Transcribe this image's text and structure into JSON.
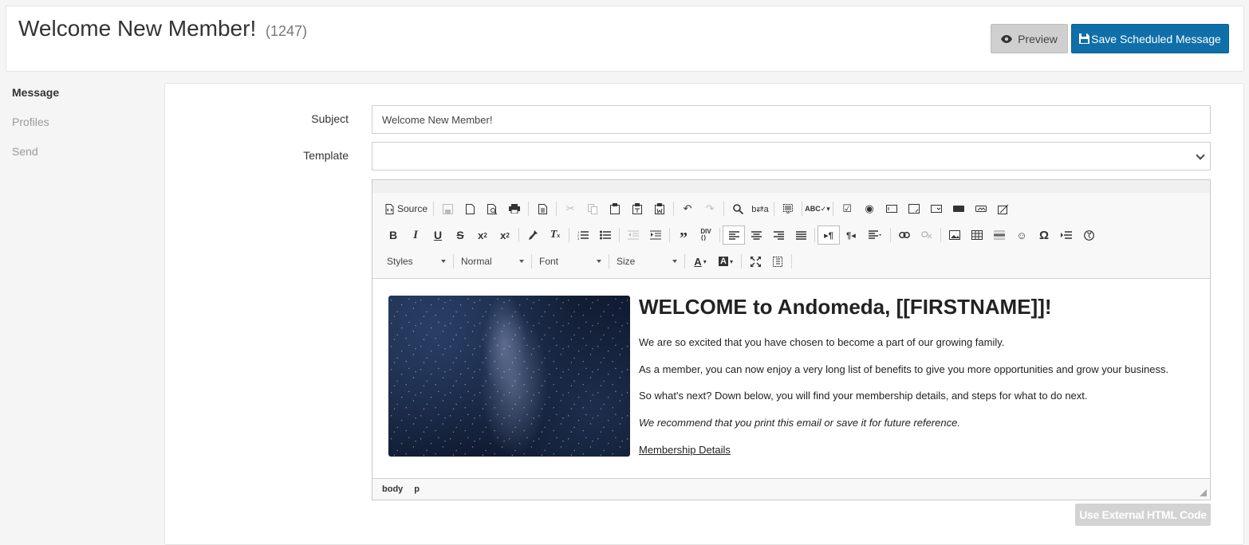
{
  "header": {
    "title": "Welcome New Member!",
    "count": "(1247)",
    "preview_label": "Preview",
    "save_label": "Save Scheduled Message"
  },
  "sidenav": {
    "items": [
      {
        "label": "Message",
        "active": true
      },
      {
        "label": "Profiles",
        "active": false
      },
      {
        "label": "Send",
        "active": false
      }
    ]
  },
  "form": {
    "subject_label": "Subject",
    "subject_value": "Welcome New Member!",
    "template_label": "Template",
    "template_value": ""
  },
  "editor": {
    "source_label": "Source",
    "styles_label": "Styles",
    "format_label": "Normal",
    "font_label": "Font",
    "size_label": "Size",
    "content": {
      "heading": "WELCOME to Andomeda, [[FIRSTNAME]]!",
      "p1": "We are so excited that you have chosen to become a part of our growing family.",
      "p2": "As a member, you can now enjoy a very long list of benefits to give you more opportunities and grow your business.",
      "p3": "So what's next? Down below, you will find your membership details, and steps for what to do next.",
      "p4": "We recommend that you print this email or save it for future reference.",
      "link": "Membership Details"
    },
    "path": [
      "body",
      "p"
    ]
  },
  "external_html_label": "Use External HTML Code",
  "colors": {
    "save_button": "#0f6fa9",
    "preview_button": "#cfcfcf",
    "disabled_button": "#d3d3d3"
  }
}
